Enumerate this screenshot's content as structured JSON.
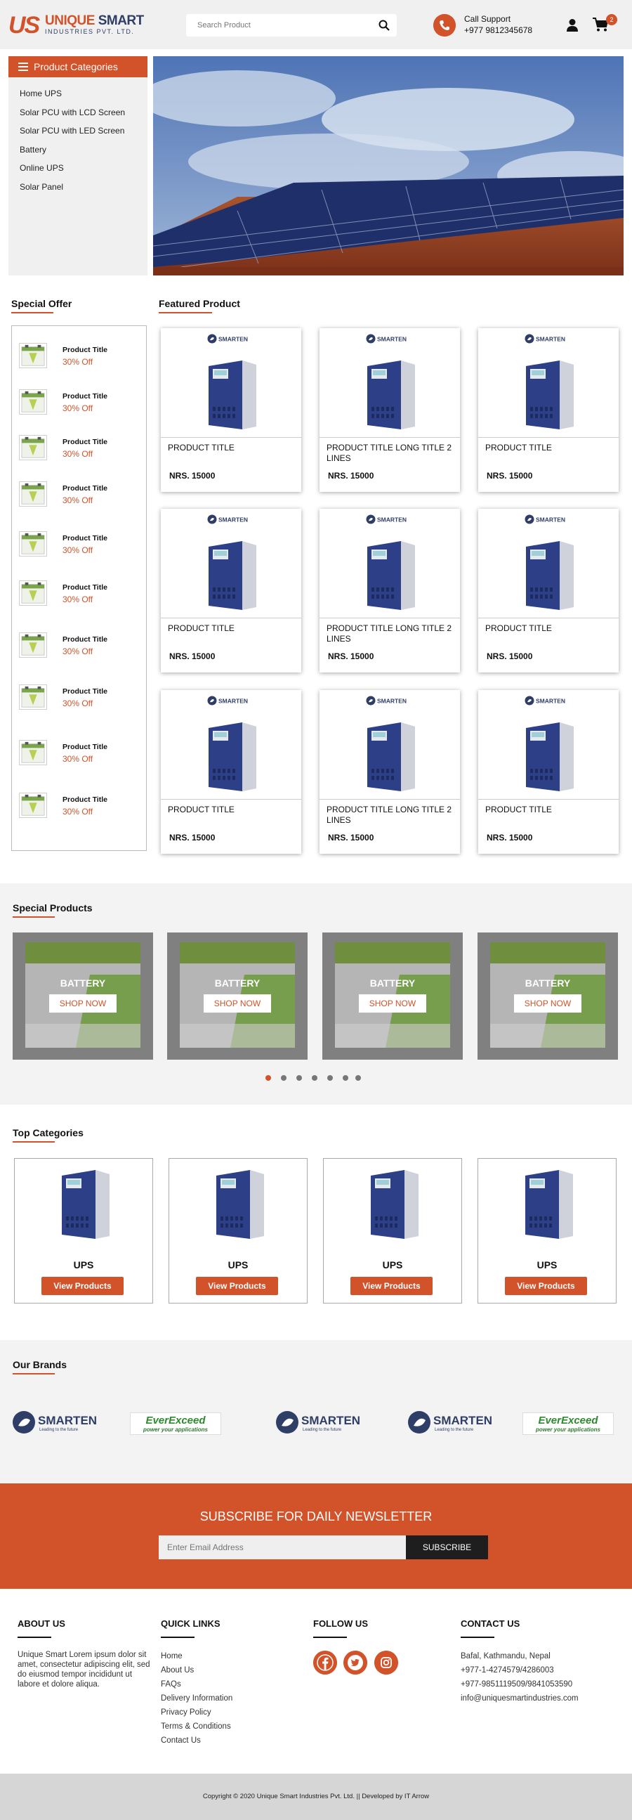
{
  "header": {
    "logo_mark": "US",
    "brand_name_1": "UNIQUE",
    "brand_name_2": "SMART",
    "brand_sub": "INDUSTRIES PVT. LTD.",
    "search_placeholder": "Search Product",
    "call_title": "Call Support",
    "call_number": "+977 9812345678",
    "cart_count": "2"
  },
  "categories": {
    "title": "Product Categories",
    "items": [
      "Home UPS",
      "Solar PCU with LCD Screen",
      "Solar PCU with LED Screen",
      "Battery",
      "Online UPS",
      "Solar Panel"
    ]
  },
  "special_offer": {
    "title": "Special Offer",
    "items": [
      {
        "title": "Product Title",
        "discount": "30% Off"
      },
      {
        "title": "Product Title",
        "discount": "30% Off"
      },
      {
        "title": "Product Title",
        "discount": "30% Off"
      },
      {
        "title": "Product Title",
        "discount": "30% Off"
      },
      {
        "title": "Product Title",
        "discount": "30% Off"
      },
      {
        "title": "Product Title",
        "discount": "30% Off"
      },
      {
        "title": "Product Title",
        "discount": "30% Off"
      },
      {
        "title": "Product Title",
        "discount": "30% Off"
      },
      {
        "title": "Product Title",
        "discount": "30% Off"
      },
      {
        "title": "Product Title",
        "discount": "30% Off"
      }
    ]
  },
  "featured": {
    "title": "Featured Product",
    "brand_label": "SMARTEN",
    "products": [
      {
        "title": "PRODUCT TITLE",
        "price": "NRS. 15000"
      },
      {
        "title": "PRODUCT TITLE LONG TITLE 2 LINES",
        "price": "NRS. 15000"
      },
      {
        "title": "PRODUCT TITLE",
        "price": "NRS. 15000"
      },
      {
        "title": "PRODUCT TITLE",
        "price": "NRS. 15000"
      },
      {
        "title": "PRODUCT TITLE LONG TITLE 2 LINES",
        "price": "NRS. 15000"
      },
      {
        "title": "PRODUCT TITLE",
        "price": "NRS. 15000"
      },
      {
        "title": "PRODUCT TITLE",
        "price": "NRS. 15000"
      },
      {
        "title": "PRODUCT TITLE LONG TITLE 2 LINES",
        "price": "NRS. 15000"
      },
      {
        "title": "PRODUCT TITLE",
        "price": "NRS. 15000"
      }
    ]
  },
  "special_products": {
    "title": "Special Products",
    "items": [
      {
        "label": "BATTERY",
        "button": "SHOP NOW"
      },
      {
        "label": "BATTERY",
        "button": "SHOP NOW"
      },
      {
        "label": "BATTERY",
        "button": "SHOP NOW"
      },
      {
        "label": "BATTERY",
        "button": "SHOP NOW"
      }
    ],
    "dots": 7,
    "active_dot": 0
  },
  "top_categories": {
    "title": "Top Categories",
    "items": [
      {
        "label": "UPS",
        "button": "View Products"
      },
      {
        "label": "UPS",
        "button": "View Products"
      },
      {
        "label": "UPS",
        "button": "View Products"
      },
      {
        "label": "UPS",
        "button": "View Products"
      }
    ]
  },
  "brands": {
    "title": "Our Brands",
    "smarten_name": "SMARTEN",
    "smarten_tagline": "Leading to the future",
    "ever_name": "EverExceed",
    "ever_tagline": "power your applications"
  },
  "newsletter": {
    "heading": "SUBSCRIBE FOR DAILY NEWSLETTER",
    "placeholder": "Enter Email Address",
    "button": "SUBSCRIBE"
  },
  "footer": {
    "about_title": "ABOUT US",
    "about_text": "Unique Smart Lorem ipsum dolor sit amet, consectetur adipiscing elit, sed do eiusmod tempor incididunt ut labore et dolore aliqua.",
    "links_title": "QUICK LINKS",
    "links": [
      "Home",
      "About Us",
      "FAQs",
      "Delivery Information",
      "Privacy Policy",
      "Terms & Conditions",
      "Contact Us"
    ],
    "follow_title": "FOLLOW US",
    "socials": [
      "facebook-icon",
      "twitter-icon",
      "instagram-icon"
    ],
    "contact_title": "CONTACT US",
    "contact": [
      "Bafal, Kathmandu, Nepal",
      "+977-1-4274579/4286003",
      "+977-9851119509/9841053590",
      "info@uniquesmartindustries.com"
    ],
    "copyright": "Copyright © 2020 Unique Smart Industries Pvt. Ltd. || Developed by IT Arrow"
  },
  "colors": {
    "accent": "#d2522a",
    "navy": "#2f3e66",
    "band": "#f3f3f3"
  }
}
